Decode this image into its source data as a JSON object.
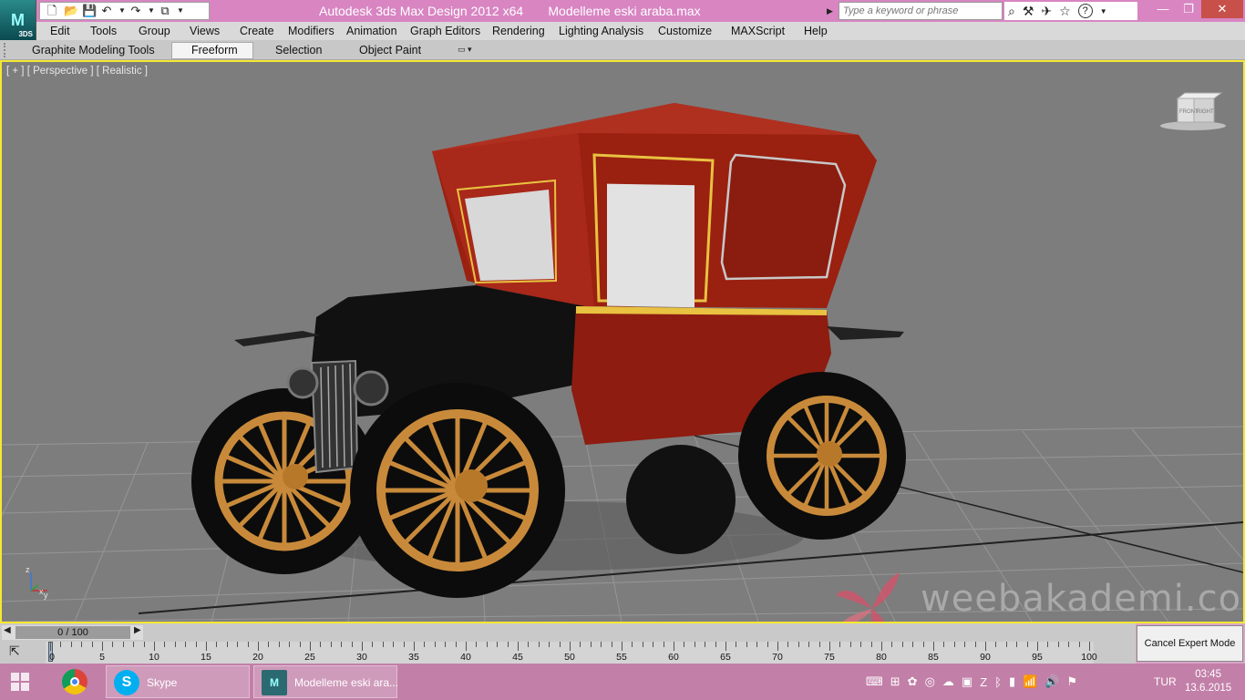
{
  "titlebar": {
    "app_logo": "3DS",
    "title": "Autodesk 3ds Max Design 2012 x64       Modelleme eski araba.max",
    "search_placeholder": "Type a keyword or phrase"
  },
  "menu": [
    "Edit",
    "Tools",
    "Group",
    "Views",
    "Create",
    "Modifiers",
    "Animation",
    "Graph Editors",
    "Rendering",
    "Lighting Analysis",
    "Customize",
    "MAXScript",
    "Help"
  ],
  "ribbon": {
    "tabs": [
      "Graphite Modeling Tools",
      "Freeform",
      "Selection",
      "Object Paint"
    ],
    "active_tab": "Freeform"
  },
  "viewport": {
    "label": "[ + ] [ Perspective ] [ Realistic ]",
    "viewcube_left": "FRONT",
    "viewcube_right": "RIGHT",
    "axis_z": "z",
    "axis_x": "x",
    "axis_y": "y",
    "watermark": "weebakademi.com"
  },
  "timeline": {
    "slider": "0 / 100",
    "ticks": [
      "0",
      "5",
      "10",
      "15",
      "20",
      "25",
      "30",
      "35",
      "40",
      "45",
      "50",
      "55",
      "60",
      "65",
      "70",
      "75",
      "80",
      "85",
      "90",
      "95",
      "100"
    ],
    "expert_button": "Cancel Expert Mode"
  },
  "taskbar": {
    "apps": [
      {
        "name": "Chrome",
        "label": ""
      },
      {
        "name": "Skype",
        "label": "Skype"
      },
      {
        "name": "3ds Max",
        "label": "Modelleme eski ara..."
      }
    ],
    "language": "TUR",
    "time": "03:45",
    "date": "13.6.2015"
  },
  "colors": {
    "titlebar": "#d885c2",
    "viewport_bg": "#7d7d7d",
    "viewport_border": "#f5e830",
    "car_body": "#9a2010",
    "wheel_spokes": "#c88a3a"
  }
}
